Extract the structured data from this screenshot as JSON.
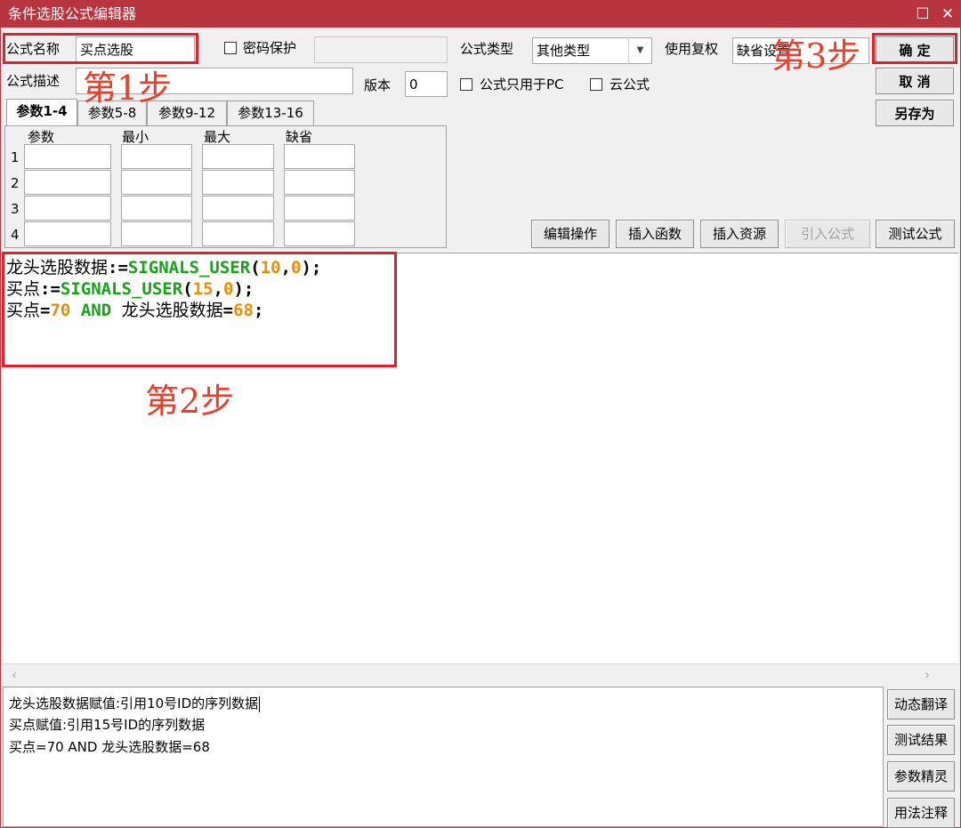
{
  "window": {
    "title": "条件选股公式编辑器",
    "maximize_icon": "maximize-icon",
    "close_icon": "close-icon"
  },
  "header": {
    "name_label": "公式名称",
    "name_value": "买点选股",
    "password_label": "密码保护",
    "type_label": "公式类型",
    "type_value": "其他类型",
    "fuquan_label": "使用复权",
    "fuquan_value": "缺省设置",
    "desc_label": "公式描述",
    "desc_value": "",
    "version_label": "版本",
    "version_value": "0",
    "pc_only_label": "公式只用于PC",
    "cloud_label": "云公式"
  },
  "buttons": {
    "ok": "确  定",
    "cancel": "取  消",
    "save_as": "另存为",
    "edit_ops": "编辑操作",
    "insert_func": "插入函数",
    "insert_res": "插入资源",
    "import_formula": "引入公式",
    "test_formula": "测试公式"
  },
  "tabs": [
    "参数1-4",
    "参数5-8",
    "参数9-12",
    "参数13-16"
  ],
  "param_table": {
    "headers": [
      "参数",
      "最小",
      "最大",
      "缺省"
    ],
    "rows": [
      "1",
      "2",
      "3",
      "4"
    ]
  },
  "code": {
    "line1": {
      "var": "龙头选股数据",
      "op": ":=",
      "fn": "SIGNALS_USER",
      "open": "(",
      "a": "10",
      "comma": ",",
      "b": "0",
      "close": ");"
    },
    "line2": {
      "var": "买点",
      "op": ":=",
      "fn": "SIGNALS_USER",
      "open": "(",
      "a": "15",
      "comma": ",",
      "b": "0",
      "close": ");"
    },
    "line3": {
      "var": "买点",
      "eq": "=",
      "num1": "70",
      "kw": "AND",
      "var2": "龙头选股数据",
      "eq2": "=",
      "num2": "68",
      "end": ";"
    }
  },
  "output_lines": [
    "龙头选股数据赋值:引用10号ID的序列数据",
    "买点赋值:引用15号ID的序列数据",
    "买点=70 AND 龙头选股数据=68"
  ],
  "side_buttons": [
    "动态翻译",
    "测试结果",
    "参数精灵",
    "用法注释"
  ],
  "annotations": {
    "step1": "第1步",
    "step2": "第2步",
    "step3": "第3步"
  },
  "colors": {
    "title_bar": "#b8343f",
    "highlight": "#e0202c",
    "step_text": "#e8402c",
    "function": "#1aa31a",
    "number": "#f08c00"
  }
}
